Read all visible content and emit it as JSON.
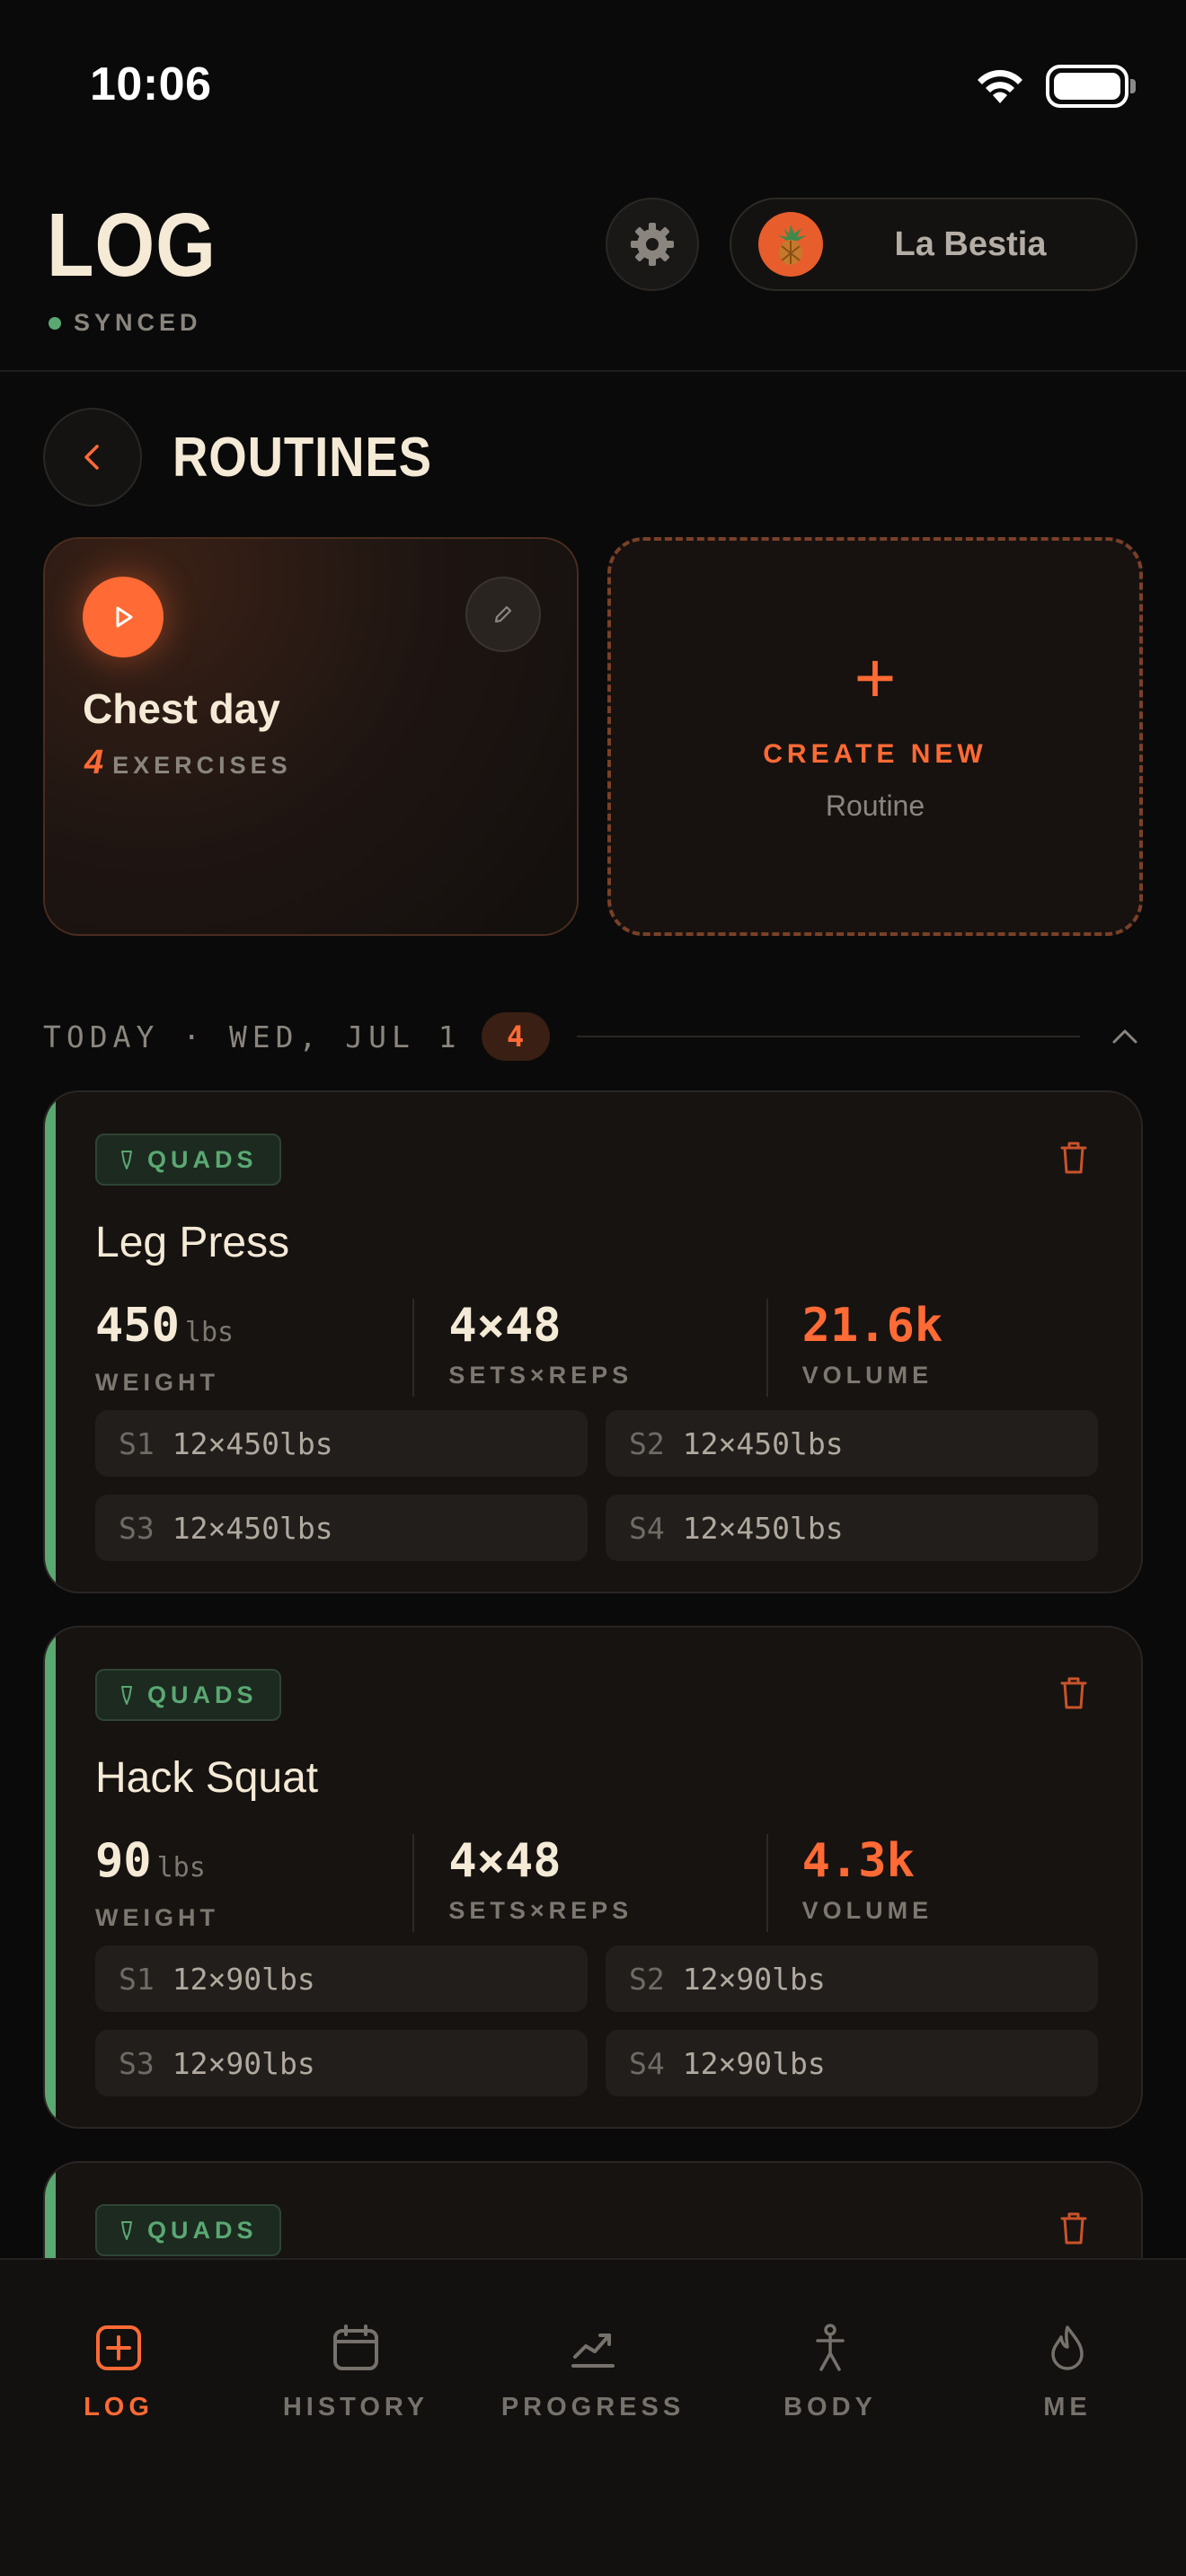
{
  "status_bar": {
    "time": "10:06"
  },
  "header": {
    "title": "LOG",
    "sync_status": "SYNCED",
    "profile_name": "La Bestia"
  },
  "routines": {
    "title": "ROUTINES",
    "items": [
      {
        "name": "Chest day",
        "count": "4",
        "count_label": "EXERCISES"
      }
    ],
    "create": {
      "label": "CREATE NEW",
      "sublabel": "Routine"
    }
  },
  "today": {
    "label": "TODAY · WED, JUL 1",
    "count": "4"
  },
  "exercises": [
    {
      "tag": "QUADS",
      "name": "Leg Press",
      "weight": "450",
      "weight_unit": "lbs",
      "weight_label": "WEIGHT",
      "sets_reps": "4×48",
      "sets_reps_label": "SETS×REPS",
      "volume": "21.6k",
      "volume_label": "VOLUME",
      "sets": [
        {
          "id": "S1",
          "value": "12×450lbs"
        },
        {
          "id": "S2",
          "value": "12×450lbs"
        },
        {
          "id": "S3",
          "value": "12×450lbs"
        },
        {
          "id": "S4",
          "value": "12×450lbs"
        }
      ]
    },
    {
      "tag": "QUADS",
      "name": "Hack Squat",
      "weight": "90",
      "weight_unit": "lbs",
      "weight_label": "WEIGHT",
      "sets_reps": "4×48",
      "sets_reps_label": "SETS×REPS",
      "volume": "4.3k",
      "volume_label": "VOLUME",
      "sets": [
        {
          "id": "S1",
          "value": "12×90lbs"
        },
        {
          "id": "S2",
          "value": "12×90lbs"
        },
        {
          "id": "S3",
          "value": "12×90lbs"
        },
        {
          "id": "S4",
          "value": "12×90lbs"
        }
      ]
    },
    {
      "tag": "QUADS"
    }
  ],
  "tabbar": {
    "items": [
      {
        "label": "LOG",
        "icon": "plus-square-icon",
        "active": true
      },
      {
        "label": "HISTORY",
        "icon": "calendar-icon"
      },
      {
        "label": "PROGRESS",
        "icon": "trend-chart-icon"
      },
      {
        "label": "BODY",
        "icon": "person-icon"
      },
      {
        "label": "ME",
        "icon": "flame-icon"
      }
    ]
  },
  "colors": {
    "accent": "#ff6a35",
    "muscle_tag": "#5aa872",
    "background": "#0a0a0a",
    "card": "#161311"
  }
}
